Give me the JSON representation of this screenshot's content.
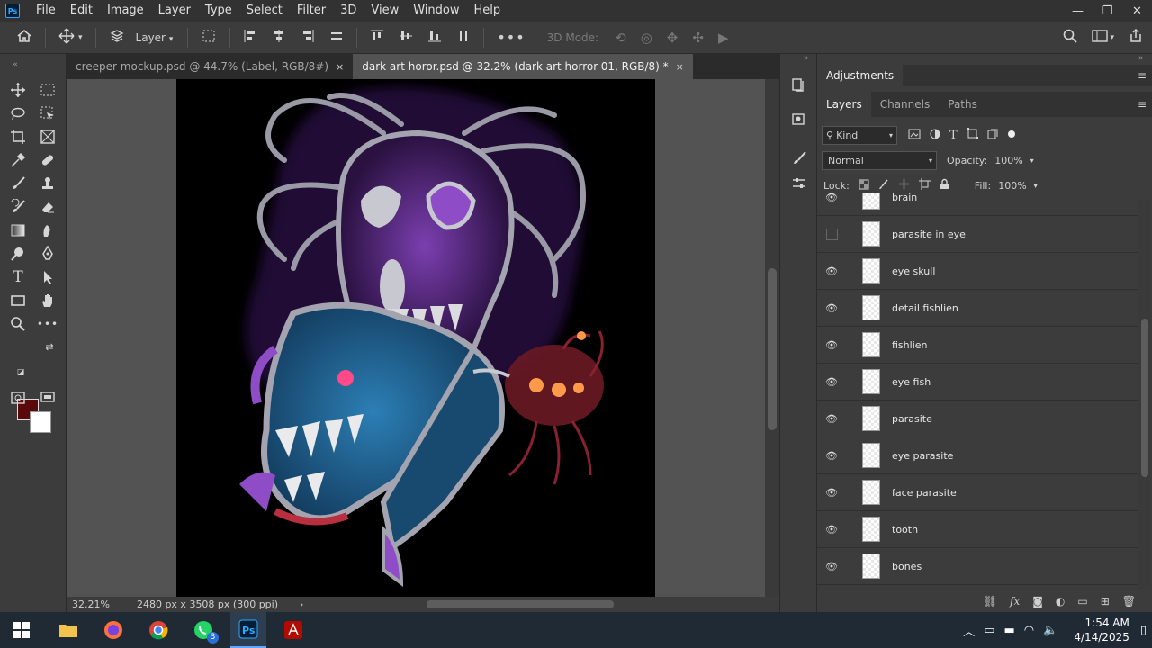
{
  "menubar": {
    "logo": "Ps",
    "items": [
      "File",
      "Edit",
      "Image",
      "Layer",
      "Type",
      "Select",
      "Filter",
      "3D",
      "View",
      "Window",
      "Help"
    ],
    "window_controls": [
      "—",
      "❐",
      "✕"
    ]
  },
  "options_bar": {
    "auto_select_target": "Layer",
    "mode_3d_label": "3D Mode:"
  },
  "tabs": [
    {
      "label": "creeper mockup.psd @ 44.7% (Label, RGB/8#)",
      "close": "×",
      "active": false
    },
    {
      "label": "dark art horor.psd @ 32.2% (dark art horror-01, RGB/8) *",
      "close": "×",
      "active": true
    }
  ],
  "status": {
    "zoom": "32.21%",
    "doc_info": "2480 px x 3508 px (300 ppi)",
    "arrow": "›"
  },
  "colors": {
    "foreground": "#5a0a0a",
    "background": "#ffffff",
    "accent": "#31a8ff"
  },
  "adjustments": {
    "title": "Adjustments"
  },
  "layers_panel": {
    "tabs": [
      "Layers",
      "Channels",
      "Paths"
    ],
    "filter_kind": "Kind",
    "blend_mode": "Normal",
    "opacity_label": "Opacity:",
    "opacity_value": "100%",
    "lock_label": "Lock:",
    "fill_label": "Fill:",
    "fill_value": "100%",
    "layers": [
      {
        "name": "brain",
        "visible": true
      },
      {
        "name": "parasite in eye",
        "visible": false
      },
      {
        "name": "eye skull",
        "visible": true
      },
      {
        "name": "detail fishlien",
        "visible": true
      },
      {
        "name": "fishlien",
        "visible": true
      },
      {
        "name": "eye fish",
        "visible": true
      },
      {
        "name": "parasite",
        "visible": true
      },
      {
        "name": "eye parasite",
        "visible": true
      },
      {
        "name": "face parasite",
        "visible": true
      },
      {
        "name": "tooth",
        "visible": true
      },
      {
        "name": "bones",
        "visible": true
      }
    ]
  },
  "taskbar": {
    "whatsapp_badge": "3",
    "time": "1:54 AM",
    "date": "4/14/2025"
  }
}
